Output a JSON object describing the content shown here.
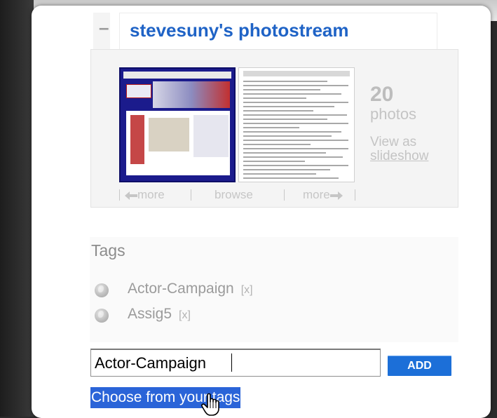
{
  "photostream": {
    "collapse_symbol": "–",
    "title": "stevesuny's photostream",
    "count": "20",
    "count_label": "photos",
    "view_as": "View as",
    "slideshow": "slideshow",
    "nav": {
      "prev": "more",
      "browse": "browse",
      "next": "more"
    }
  },
  "tags": {
    "heading": "Tags",
    "items": [
      {
        "name": "Actor-Campaign",
        "remove": "[x]"
      },
      {
        "name": "Assig5",
        "remove": "[x]"
      }
    ]
  },
  "tag_input": {
    "value": "Actor-Campaign"
  },
  "add_button": {
    "label": "ADD"
  },
  "choose_link": {
    "label": "Choose from your tags"
  },
  "icons": {
    "collapse": "minus-icon",
    "tag": "globe-icon",
    "prev_arrow": "left-arrow-icon",
    "next_arrow": "right-arrow-icon",
    "cursor": "hand-pointer-icon"
  },
  "colors": {
    "title_blue": "#1f63c6",
    "button_blue": "#1c6fd8",
    "selection_blue": "#2a64d8"
  }
}
